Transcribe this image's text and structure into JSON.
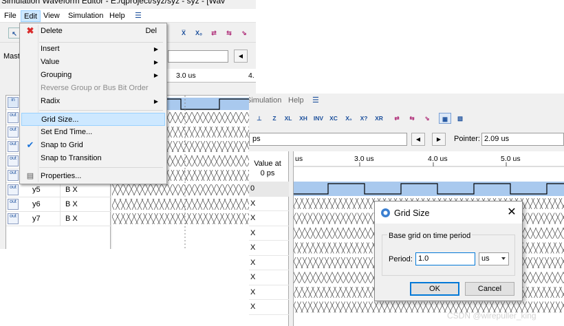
{
  "window_back": {
    "title": "Simulation Waveform Editor - E:/qproject/syz/syz - syz - [Wav",
    "menubar": [
      "File",
      "Edit",
      "View",
      "Simulation",
      "Help"
    ],
    "master_label": "Mast",
    "time_ticks": [
      "3.0 us",
      "4."
    ],
    "signals": [
      {
        "name": "y5",
        "value": "B X"
      },
      {
        "name": "y6",
        "value": "B X"
      },
      {
        "name": "y7",
        "value": "B X"
      }
    ],
    "row_icon_labels": [
      "in",
      "out",
      "out",
      "out",
      "out",
      "out",
      "out",
      "out",
      "out"
    ]
  },
  "edit_menu": {
    "items": [
      {
        "label": "Delete",
        "shortcut": "Del",
        "icon": "red-x-icon"
      },
      {
        "label": "Insert",
        "submenu": true
      },
      {
        "label": "Value",
        "submenu": true
      },
      {
        "label": "Grouping",
        "submenu": true
      },
      {
        "label": "Reverse Group or Bus Bit Order",
        "disabled": true
      },
      {
        "label": "Radix",
        "submenu": true
      },
      {
        "label": "Grid Size...",
        "highlighted": true
      },
      {
        "label": "Set End Time..."
      },
      {
        "label": "Snap to Grid",
        "checked": true
      },
      {
        "label": "Snap to Transition"
      },
      {
        "label": "Properties...",
        "icon": "properties-icon"
      }
    ]
  },
  "window_front": {
    "menubar": [
      "Simulation",
      "Help"
    ],
    "search_value": "ps",
    "pointer_label": "Pointer:",
    "pointer_value": "2.09 us",
    "value_header": "Value at\n0 ps",
    "values": [
      "0",
      "X",
      "X",
      "X",
      "X",
      "X",
      "X",
      "X",
      "X"
    ],
    "time_ticks": [
      "us",
      "3.0 us",
      "4.0 us",
      "5.0 us"
    ]
  },
  "dialog": {
    "title": "Grid Size",
    "group_label": "Base grid on time period",
    "period_label": "Period:",
    "period_value": "1.0",
    "unit_value": "us",
    "ok_label": "OK",
    "cancel_label": "Cancel"
  },
  "watermark": "CSDN @wirepuller_king",
  "colors": {
    "menu_highlight": "#cde8ff",
    "clock_fill": "#a9c9ee",
    "accent_blue": "#0078d7"
  }
}
